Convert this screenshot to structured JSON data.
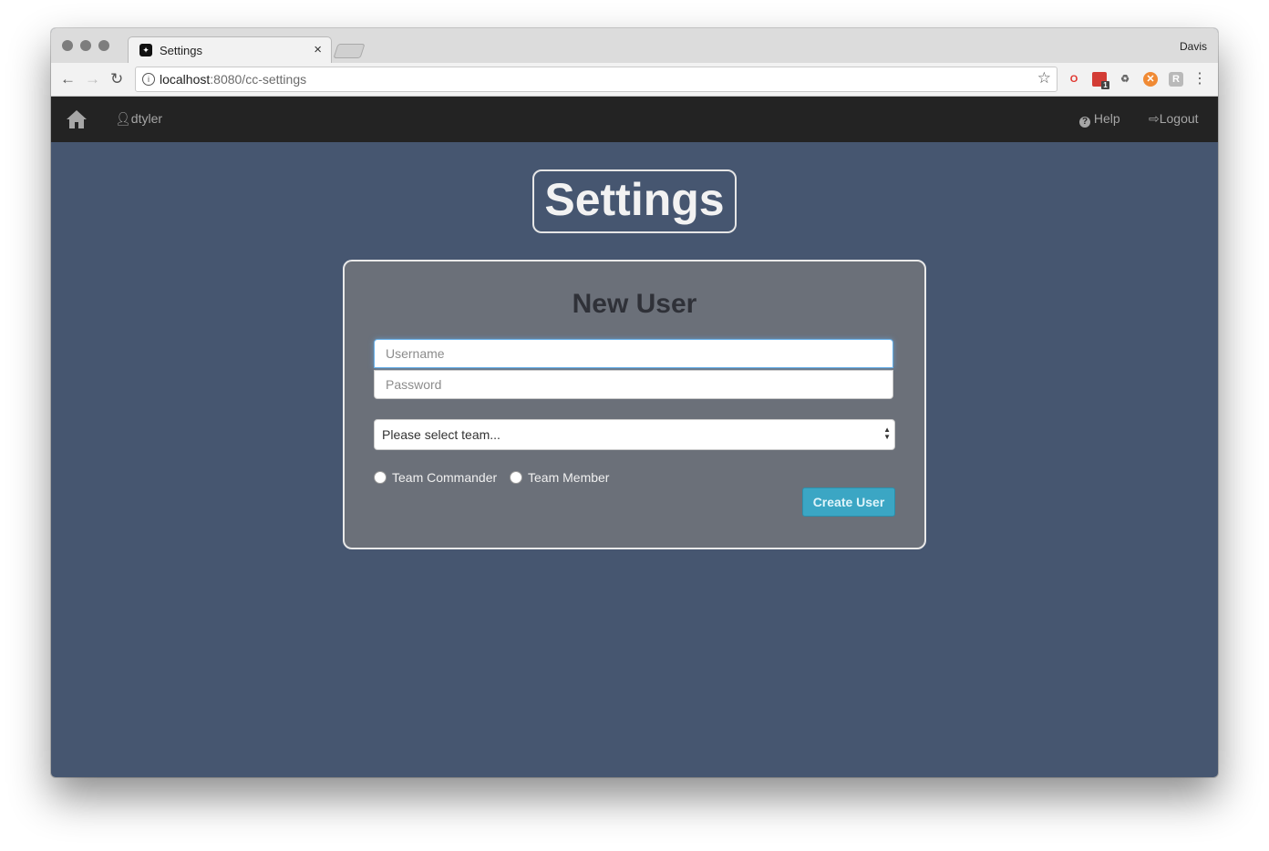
{
  "browser": {
    "tab_title": "Settings",
    "tab_close": "×",
    "profile_name": "Davis",
    "url_host": "localhost",
    "url_path": ":8080/cc-settings",
    "extensions": [
      "opera-icon",
      "calendar-icon",
      "recycle-icon",
      "orange-extension-icon",
      "gray-extension-icon"
    ],
    "calendar_badge": "1"
  },
  "navbar": {
    "user_label": "dtyler",
    "help_label": "Help",
    "logout_label": "Logout"
  },
  "page": {
    "title": "Settings"
  },
  "form": {
    "heading": "New User",
    "username_placeholder": "Username",
    "password_placeholder": "Password",
    "team_select": "Please select team...",
    "radio_commander": "Team Commander",
    "radio_member": "Team Member",
    "submit_label": "Create User"
  },
  "colors": {
    "page_bg": "#465670",
    "navbar_bg": "#232323",
    "card_bg": "#6b7079",
    "button_bg": "#3ba6c4"
  }
}
